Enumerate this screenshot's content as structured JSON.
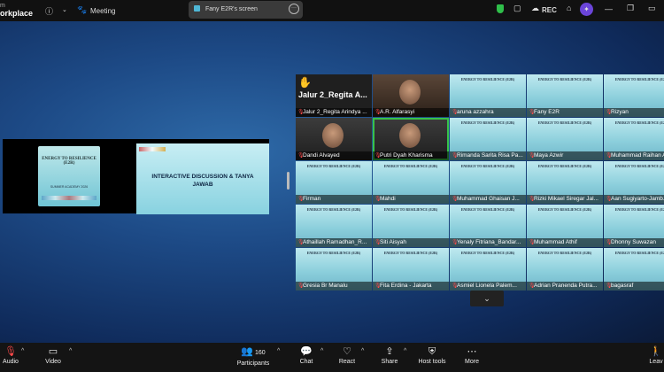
{
  "app": {
    "brand_line1": "m",
    "brand_line2": "orkplace",
    "meeting_label": "Meeting"
  },
  "share": {
    "label": "Fany E2R's screen"
  },
  "top_right": {
    "rec_label": "REC"
  },
  "slides": {
    "left_title": "ENERGY TO RESILIENCE (E2R)",
    "left_sub": "SUMMER ACADEMY 2026",
    "right_title": "INTERACTIVE DISCUSSION & TANYA JAWAB"
  },
  "featured": {
    "big_name": "Jalur 2_Regita A..."
  },
  "tile_slide_title": "ENERGY TO RESILIENCE (E2R)",
  "participants": [
    "Jalur 2_Regita Arindya ...",
    "A.R. Alfarasyi",
    "aruna azzahra",
    "Fany E2R",
    "Rizyan",
    "Dandi Alvayed",
    "Putri Dyah Kharisma",
    "Rimanda Sarita Risa Pa...",
    "Maya Azwir",
    "Muhammad Raihan Az...",
    "Firman",
    "Mahdi",
    "Muhammad Ghaisan J...",
    "Rizki Mikael Siregar Jal...",
    "Aan Sugiyarto-Jamb...",
    "Athaillah Ramadhan_R...",
    "Siti Aisyah",
    "Yenaly Fitriana_Bandar...",
    "Muhammad Athif",
    "Dhonny Suwazan",
    "Gresia Br Manalu",
    "Fita Erdina - Jakarta",
    "Asmiel Lionela Palem...",
    "Adrian Pranenda Putra...",
    "bagasraf"
  ],
  "toolbar": {
    "audio": "Audio",
    "video": "Video",
    "participants": "Participants",
    "participants_count": "160",
    "chat": "Chat",
    "react": "React",
    "share": "Share",
    "host_tools": "Host tools",
    "more": "More",
    "leave": "Leav"
  }
}
